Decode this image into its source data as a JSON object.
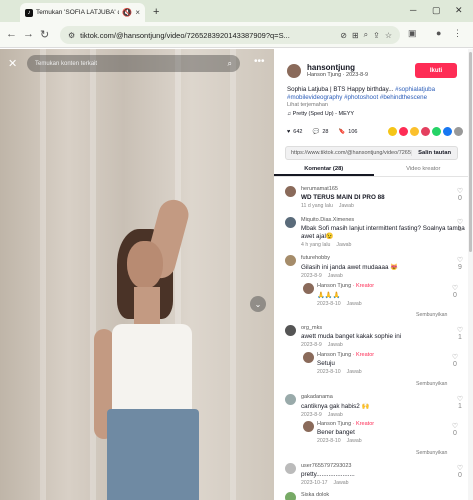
{
  "browser": {
    "tab_title": "Temukan 'SOFIA LATJUBA' di",
    "url": "tiktok.com/@hansontjung/video/7265283920143387909?q=S..."
  },
  "video": {
    "search_placeholder": "Temukan konten terkait"
  },
  "post": {
    "author_id": "hansontjung",
    "author_sub": "Hanson Tjung · 2023-8-9",
    "follow_label": "Ikuti",
    "description": "Sophia Latjuba | BTS Happy birthday...",
    "tags": "#sophialatjuba #mobilevideography #photoshoot #behindthescene",
    "translate": "Lihat terjemahan",
    "music": "♫ Pretty (Sped Up) - MEYY",
    "likes": "642",
    "comments": "28",
    "bookmarks": "106",
    "link": "https://www.tiktok.com/@hansontjung/video/7265...",
    "copy_label": "Salin tautan"
  },
  "tabs": {
    "comments": "Komentar (28)",
    "creator": "Video kreator"
  },
  "comments": [
    {
      "user": "herumamat165",
      "text": "WD TERUS MAIN DI PRO 88",
      "meta": "11 d yang lalu",
      "reply": "Jawab",
      "likes": "0",
      "bold": true
    },
    {
      "user": "Miquito.Dias.Ximenes",
      "text": "Mbak Sofi masih lanjut intermittent fasting? Soalnya tamba awet ajal😉",
      "meta": "4 h yang lalu",
      "reply": "Jawab",
      "likes": "1"
    },
    {
      "user": "futurehobby",
      "text": "Gilasih ini janda awet mudaaaa 😻",
      "meta": "2023-8-9",
      "reply": "Jawab",
      "likes": "9"
    },
    {
      "user": "org_mks",
      "text": "awett muda banget kakak sophie ini",
      "meta": "2023-8-9",
      "reply": "Jawab",
      "likes": "1"
    },
    {
      "user": "gakadanama",
      "text": "cantiknya gak habis2 🙌",
      "meta": "2023-8-9",
      "reply": "Jawab",
      "likes": "1"
    },
    {
      "user": "user7655797293023",
      "text": "pretty......................",
      "meta": "2023-10-17",
      "reply": "Jawab",
      "likes": "0"
    },
    {
      "user": "Siska dolok",
      "text": "",
      "meta": "",
      "reply": "",
      "likes": ""
    }
  ],
  "replies": [
    {
      "user": "Hanson Tjung",
      "creator": " · Kreator",
      "text": "🙏🙏🙏",
      "meta": "2023-8-10",
      "reply": "Jawab",
      "likes": "0"
    },
    {
      "user": "Hanson Tjung",
      "creator": " · Kreator",
      "text": "Setuju",
      "meta": "2023-8-10",
      "reply": "Jawab",
      "likes": "0"
    },
    {
      "user": "Hanson Tjung",
      "creator": " · Kreator",
      "text": "Bener banget",
      "meta": "2023-8-10",
      "reply": "Jawab",
      "likes": "0"
    }
  ],
  "hide_label": "Sembunyikan"
}
